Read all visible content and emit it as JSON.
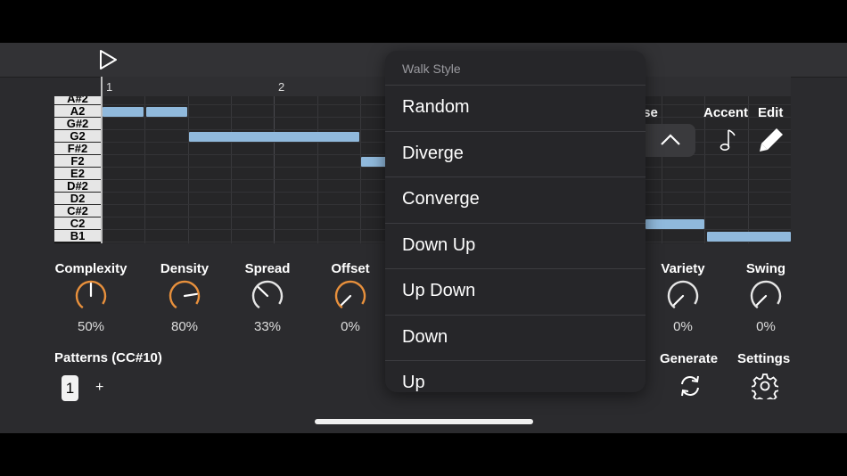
{
  "toolbar": {
    "play_icon": "play-icon"
  },
  "ruler": {
    "bar1": "1",
    "bar2": "2"
  },
  "piano_keys": [
    "A#2",
    "A2",
    "G#2",
    "G2",
    "F#2",
    "F2",
    "E2",
    "D#2",
    "D2",
    "C#2",
    "C2",
    "B1"
  ],
  "header": {
    "transpose_partial": "ose",
    "accent": "Accent",
    "edit": "Edit"
  },
  "knobs_left": [
    {
      "label": "Complexity",
      "value": "50%",
      "level": 0.5,
      "color": "#e8903c"
    },
    {
      "label": "Density",
      "value": "80%",
      "level": 0.8,
      "color": "#e8903c"
    },
    {
      "label": "Spread",
      "value": "33%",
      "level": 0.33,
      "color": "#e6e6e6"
    },
    {
      "label": "Offset",
      "value": "0%",
      "level": 0.0,
      "color": "#e8903c"
    }
  ],
  "knobs_right": [
    {
      "label": "Variety",
      "value": "0%",
      "level": 0.0,
      "color": "#e6e6e6"
    },
    {
      "label": "Swing",
      "value": "0%",
      "level": 0.0,
      "color": "#e6e6e6"
    }
  ],
  "patterns": {
    "title": "Patterns (CC#10)",
    "selected": "1",
    "add": "+"
  },
  "actions": {
    "generate": "Generate",
    "settings": "Settings"
  },
  "walk_style": {
    "title": "Walk Style",
    "options": [
      "Random",
      "Diverge",
      "Converge",
      "Down Up",
      "Up Down",
      "Down",
      "Up"
    ]
  }
}
